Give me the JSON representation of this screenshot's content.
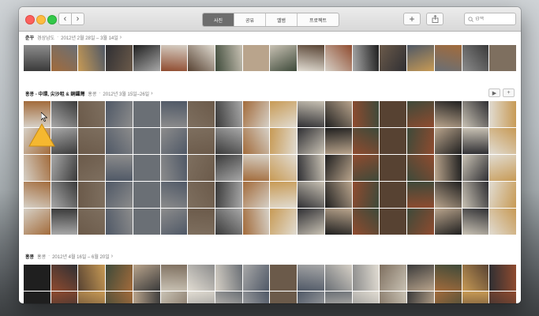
{
  "toolbar": {
    "tabs": [
      {
        "label": "사진",
        "active": true
      },
      {
        "label": "공유",
        "active": false
      },
      {
        "label": "앨범",
        "active": false
      },
      {
        "label": "프로젝트",
        "active": false
      }
    ],
    "add_label": "+",
    "search_placeholder": "검색"
  },
  "moments": [
    {
      "title": "춘꾸",
      "location": "경상남도",
      "date": "2012년 2월 28일 – 3월 14일",
      "chevron": "›"
    },
    {
      "title": "홍콩 - 中環, 尖沙咀 & 銅鑼灣",
      "location": "홍콩",
      "date": "2012년 3월 15일–26일",
      "chevron": "›"
    },
    {
      "title": "홍콩",
      "location": "홍콩",
      "date": "2012년 4월 16일 – 6월 20일",
      "chevron": "›"
    }
  ],
  "colors": {
    "photo_palette": [
      "#3a3a3a",
      "#6b5a4a",
      "#b9a48c",
      "#2f2f33",
      "#8c8c8c",
      "#d6d0c6",
      "#574232",
      "#a26b3b",
      "#4f5866",
      "#c9c2b4",
      "#1f1f1f",
      "#7e6f5f",
      "#a8a8a8",
      "#3e4a3a",
      "#c79a55",
      "#6a6f75",
      "#e1dcd2",
      "#8f4b2f"
    ],
    "accent_warning": "#f5b830"
  }
}
